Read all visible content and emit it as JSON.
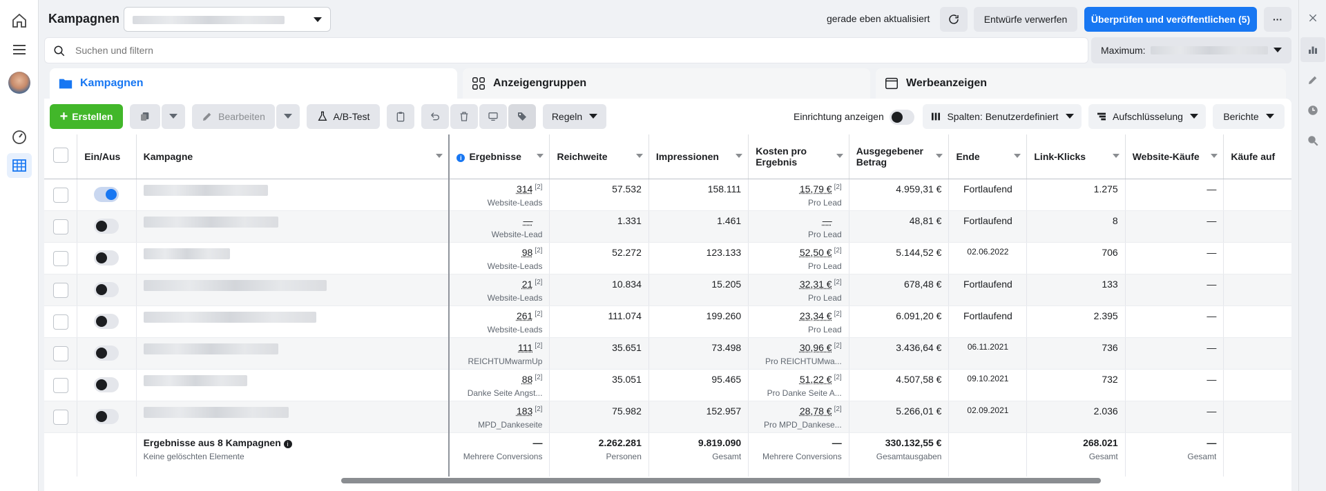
{
  "header": {
    "title": "Kampagnen",
    "updated": "gerade eben aktualisiert",
    "discard_label": "Entwürfe verwerfen",
    "publish_label": "Überprüfen und veröffentlichen (5)",
    "more_label": "···"
  },
  "search": {
    "placeholder": "Suchen und filtern"
  },
  "maximum": {
    "label": "Maximum:"
  },
  "tabs": [
    {
      "label": "Kampagnen"
    },
    {
      "label": "Anzeigengruppen"
    },
    {
      "label": "Werbeanzeigen"
    }
  ],
  "toolbar": {
    "create": "Erstellen",
    "edit": "Bearbeiten",
    "abtest": "A/B-Test",
    "rules": "Regeln",
    "setup": "Einrichtung anzeigen",
    "columns": "Spalten: Benutzerdefiniert",
    "breakdown": "Aufschlüsselung",
    "reports": "Berichte"
  },
  "table": {
    "headers": [
      "Ein/Aus",
      "Kampagne",
      "Ergebnisse",
      "Reichweite",
      "Impressionen",
      "Kosten pro Ergebnis",
      "Ausgegebener Betrag",
      "Ende",
      "Link-Klicks",
      "Website-Käufe",
      "Käufe auf"
    ],
    "rows": [
      {
        "on": true,
        "result": "314",
        "result_sub": "Website-Leads",
        "reach": "57.532",
        "impr": "158.111",
        "cost": "15,79 €",
        "cost_sub": "Pro Lead",
        "spent": "4.959,31 €",
        "end": "Fortlaufend",
        "clicks": "1.275",
        "buys": "—"
      },
      {
        "on": false,
        "result": "—",
        "result_sub": "Website-Lead",
        "reach": "1.331",
        "impr": "1.461",
        "cost": "—",
        "cost_sub": "Pro Lead",
        "spent": "48,81 €",
        "end": "Fortlaufend",
        "clicks": "8",
        "buys": "—"
      },
      {
        "on": false,
        "result": "98",
        "result_sub": "Website-Leads",
        "reach": "52.272",
        "impr": "123.133",
        "cost": "52,50 €",
        "cost_sub": "Pro Lead",
        "spent": "5.144,52 €",
        "end": "02.06.2022",
        "clicks": "706",
        "buys": "—"
      },
      {
        "on": false,
        "result": "21",
        "result_sub": "Website-Leads",
        "reach": "10.834",
        "impr": "15.205",
        "cost": "32,31 €",
        "cost_sub": "Pro Lead",
        "spent": "678,48 €",
        "end": "Fortlaufend",
        "clicks": "133",
        "buys": "—"
      },
      {
        "on": false,
        "result": "261",
        "result_sub": "Website-Leads",
        "reach": "111.074",
        "impr": "199.260",
        "cost": "23,34 €",
        "cost_sub": "Pro Lead",
        "spent": "6.091,20 €",
        "end": "Fortlaufend",
        "clicks": "2.395",
        "buys": "—"
      },
      {
        "on": false,
        "result": "111",
        "result_sub": "REICHTUMwarmUp",
        "reach": "35.651",
        "impr": "73.498",
        "cost": "30,96 €",
        "cost_sub": "Pro REICHTUMwa...",
        "spent": "3.436,64 €",
        "end": "06.11.2021",
        "clicks": "736",
        "buys": "—"
      },
      {
        "on": false,
        "result": "88",
        "result_sub": "Danke Seite Angst...",
        "reach": "35.051",
        "impr": "95.465",
        "cost": "51,22 €",
        "cost_sub": "Pro Danke Seite A...",
        "spent": "4.507,58 €",
        "end": "09.10.2021",
        "clicks": "732",
        "buys": "—"
      },
      {
        "on": false,
        "result": "183",
        "result_sub": "MPD_Dankeseite",
        "reach": "75.982",
        "impr": "152.957",
        "cost": "28,78 €",
        "cost_sub": "Pro MPD_Dankese...",
        "spent": "5.266,01 €",
        "end": "02.09.2021",
        "clicks": "2.036",
        "buys": "—"
      }
    ],
    "sup": "[2]",
    "summary": {
      "label": "Ergebnisse aus 8 Kampagnen",
      "sub": "Keine gelöschten Elemente",
      "result": "—",
      "result_sub": "Mehrere Conversions",
      "reach": "2.262.281",
      "reach_sub": "Personen",
      "impr": "9.819.090",
      "impr_sub": "Gesamt",
      "cost": "—",
      "cost_sub": "Mehrere Conversions",
      "spent": "330.132,55 €",
      "spent_sub": "Gesamtausgaben",
      "clicks": "268.021",
      "clicks_sub": "Gesamt",
      "buys": "—",
      "buys_sub": "Gesamt"
    }
  }
}
